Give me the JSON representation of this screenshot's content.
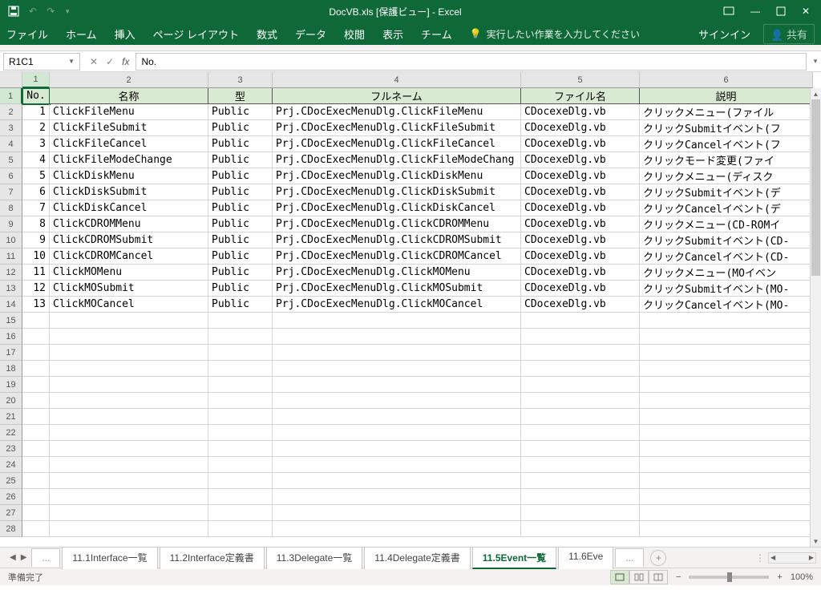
{
  "window": {
    "title": "DocVB.xls  [保護ビュー] - Excel",
    "signin": "サインイン",
    "share": "共有"
  },
  "ribbon": {
    "tabs": [
      "ファイル",
      "ホーム",
      "挿入",
      "ページ レイアウト",
      "数式",
      "データ",
      "校閲",
      "表示",
      "チーム"
    ],
    "tell_me": "実行したい作業を入力してください"
  },
  "namebox": "R1C1",
  "formula": "No.",
  "columns": [
    "1",
    "2",
    "3",
    "4",
    "5",
    "6"
  ],
  "headers": [
    "No.",
    "名称",
    "型",
    "フルネーム",
    "ファイル名",
    "説明"
  ],
  "rows": [
    {
      "no": "1",
      "name": "ClickFileMenu",
      "type": "Public",
      "full": "Prj.CDocExecMenuDlg.ClickFileMenu",
      "file": "CDocexeDlg.vb",
      "desc": "クリックメニュー(ファイル"
    },
    {
      "no": "2",
      "name": "ClickFileSubmit",
      "type": "Public",
      "full": "Prj.CDocExecMenuDlg.ClickFileSubmit",
      "file": "CDocexeDlg.vb",
      "desc": "クリックSubmitイベント(フ"
    },
    {
      "no": "3",
      "name": "ClickFileCancel",
      "type": "Public",
      "full": "Prj.CDocExecMenuDlg.ClickFileCancel",
      "file": "CDocexeDlg.vb",
      "desc": "クリックCancelイベント(フ"
    },
    {
      "no": "4",
      "name": "ClickFileModeChange",
      "type": "Public",
      "full": "Prj.CDocExecMenuDlg.ClickFileModeChang",
      "file": "CDocexeDlg.vb",
      "desc": "クリックモード変更(ファイ"
    },
    {
      "no": "5",
      "name": "ClickDiskMenu",
      "type": "Public",
      "full": "Prj.CDocExecMenuDlg.ClickDiskMenu",
      "file": "CDocexeDlg.vb",
      "desc": "クリックメニュー(ディスク"
    },
    {
      "no": "6",
      "name": "ClickDiskSubmit",
      "type": "Public",
      "full": "Prj.CDocExecMenuDlg.ClickDiskSubmit",
      "file": "CDocexeDlg.vb",
      "desc": "クリックSubmitイベント(デ"
    },
    {
      "no": "7",
      "name": "ClickDiskCancel",
      "type": "Public",
      "full": "Prj.CDocExecMenuDlg.ClickDiskCancel",
      "file": "CDocexeDlg.vb",
      "desc": "クリックCancelイベント(デ"
    },
    {
      "no": "8",
      "name": "ClickCDROMMenu",
      "type": "Public",
      "full": "Prj.CDocExecMenuDlg.ClickCDROMMenu",
      "file": "CDocexeDlg.vb",
      "desc": "クリックメニュー(CD-ROMイ"
    },
    {
      "no": "9",
      "name": "ClickCDROMSubmit",
      "type": "Public",
      "full": "Prj.CDocExecMenuDlg.ClickCDROMSubmit",
      "file": "CDocexeDlg.vb",
      "desc": "クリックSubmitイベント(CD-"
    },
    {
      "no": "10",
      "name": "ClickCDROMCancel",
      "type": "Public",
      "full": "Prj.CDocExecMenuDlg.ClickCDROMCancel",
      "file": "CDocexeDlg.vb",
      "desc": "クリックCancelイベント(CD-"
    },
    {
      "no": "11",
      "name": "ClickMOMenu",
      "type": "Public",
      "full": "Prj.CDocExecMenuDlg.ClickMOMenu",
      "file": "CDocexeDlg.vb",
      "desc": "クリックメニュー(MOイベン"
    },
    {
      "no": "12",
      "name": "ClickMOSubmit",
      "type": "Public",
      "full": "Prj.CDocExecMenuDlg.ClickMOSubmit",
      "file": "CDocexeDlg.vb",
      "desc": "クリックSubmitイベント(MO-"
    },
    {
      "no": "13",
      "name": "ClickMOCancel",
      "type": "Public",
      "full": "Prj.CDocExecMenuDlg.ClickMOCancel",
      "file": "CDocexeDlg.vb",
      "desc": "クリックCancelイベント(MO-"
    }
  ],
  "empty_rows": 14,
  "sheet_tabs": {
    "ellipsis": "...",
    "tabs": [
      "11.1Interface一覧",
      "11.2Interface定義書",
      "11.3Delegate一覧",
      "11.4Delegate定義書",
      "11.5Event一覧",
      "11.6Eve"
    ],
    "active": "11.5Event一覧",
    "more": "..."
  },
  "status": {
    "ready": "準備完了",
    "zoom": "100%"
  }
}
